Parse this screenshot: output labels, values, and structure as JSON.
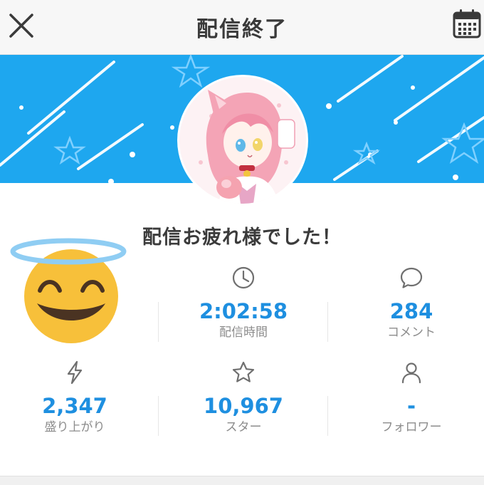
{
  "header": {
    "title": "配信終了",
    "close_icon": "close-icon",
    "calendar_icon": "calendar-icon"
  },
  "banner": {
    "background_color": "#1ea7ef"
  },
  "main": {
    "message": "配信お疲れ様でした！",
    "stats": [
      {
        "id": "duration",
        "icon": "clock-icon",
        "value": "2:02:58",
        "label": "配信時間"
      },
      {
        "id": "comments",
        "icon": "comment-icon",
        "value": "284",
        "label": "コメント"
      },
      {
        "id": "excitement",
        "icon": "lightning-icon",
        "value": "2,347",
        "label": "盛り上がり"
      },
      {
        "id": "stars",
        "icon": "star-icon",
        "value": "10,967",
        "label": "スター"
      },
      {
        "id": "followers",
        "icon": "person-icon",
        "value": "-",
        "label": "フォロワー"
      }
    ]
  },
  "colors": {
    "accent": "#1e8fe0",
    "label": "#8c8c8c"
  }
}
